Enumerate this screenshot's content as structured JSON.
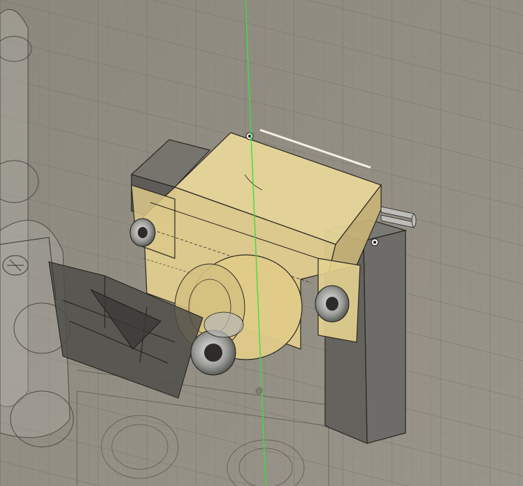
{
  "viewport": {
    "background": "#8f8b80",
    "grid_color": "#6f6b62",
    "axis_color": "#3fdc3f"
  },
  "model": {
    "body_color": "#e8d596",
    "body_shadow": "#c8b476",
    "body_dark": "#a89a6a",
    "frame_color": "#6e6c68",
    "edge_color": "#2a2722",
    "ghost_color": "#a3a199",
    "bearing_color": "#b9b9b6",
    "ghost_text": "@"
  }
}
